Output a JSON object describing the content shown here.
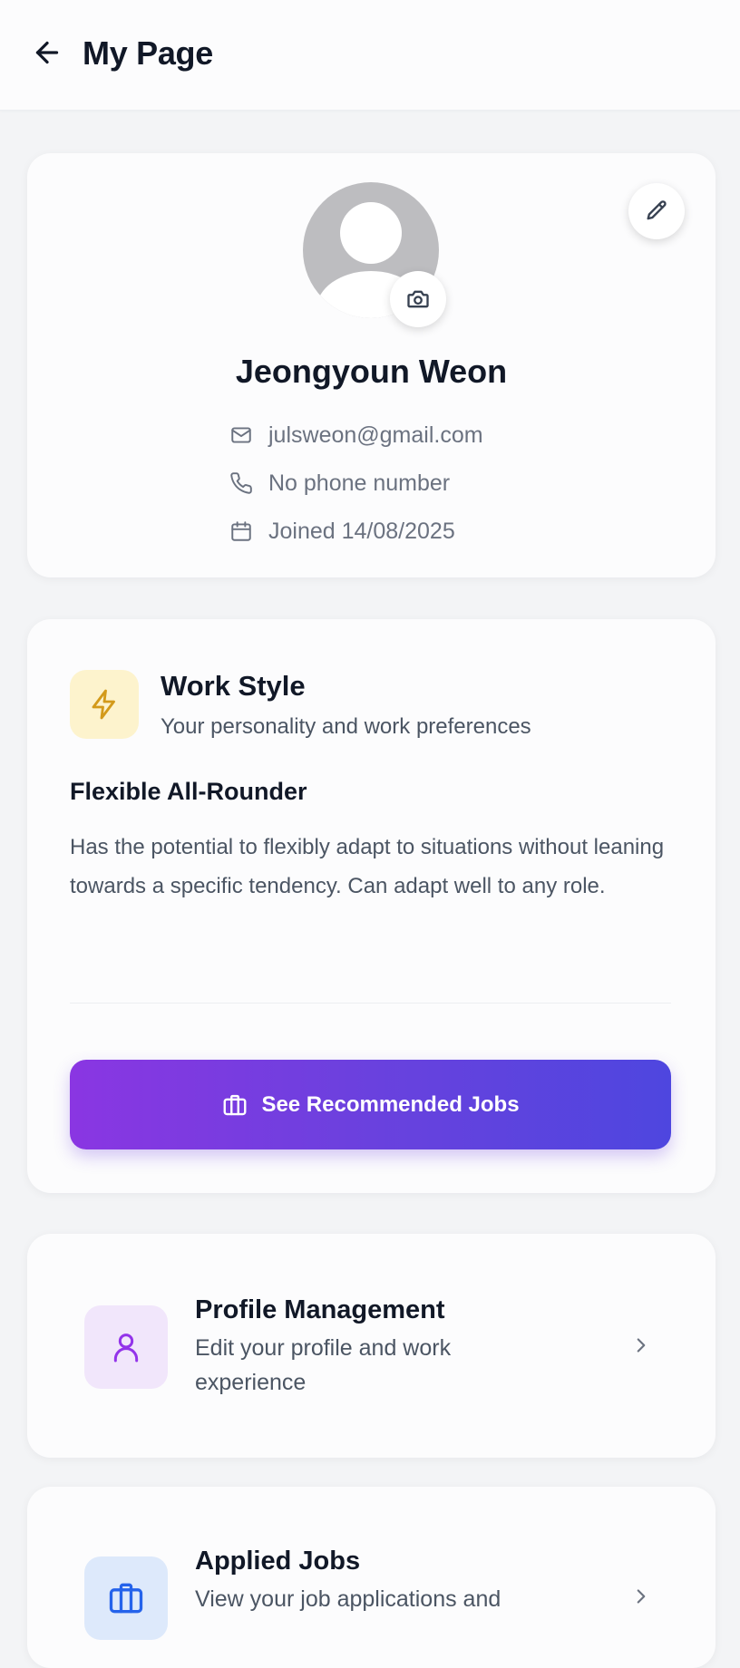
{
  "header": {
    "title": "My Page",
    "back_icon": "arrow-left-icon"
  },
  "profile": {
    "name": "Jeongyoun Weon",
    "email": "julsweon@gmail.com",
    "phone": "No phone number",
    "joined": "Joined 14/08/2025",
    "icons": [
      "mail-icon",
      "phone-icon",
      "calendar-icon",
      "camera-icon",
      "pencil-icon"
    ]
  },
  "work_style": {
    "title": "Work Style",
    "subtitle": "Your personality and work preferences",
    "type": "Flexible All-Rounder",
    "description": "Has the potential to flexibly adapt to situations without leaning towards a specific tendency. Can adapt well to any role.",
    "button_label": "See Recommended Jobs",
    "icon": "lightning-icon",
    "accent": "#d39a1a"
  },
  "menu": [
    {
      "title": "Profile Management",
      "description": "Edit your profile and work experience",
      "icon": "user-icon",
      "icon_bg": "#f1e6fb",
      "icon_color": "#9333ea"
    },
    {
      "title": "Applied Jobs",
      "description": "View your job applications and",
      "icon": "briefcase-icon",
      "icon_bg": "#dde9fb",
      "icon_color": "#2563eb"
    }
  ],
  "colors": {
    "gradient_start": "#8a36e2",
    "gradient_end": "#4e46df",
    "text_muted": "#6b7280"
  }
}
